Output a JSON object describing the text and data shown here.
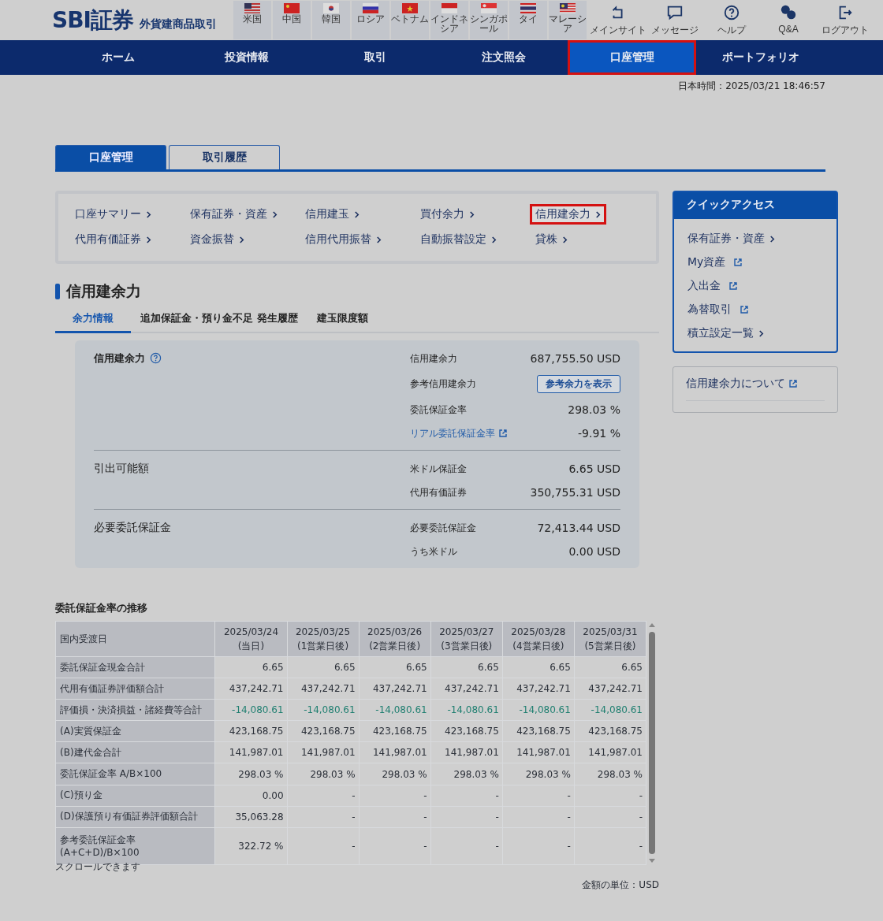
{
  "header": {
    "logo": "SBI証券",
    "subtitle": "外貨建商品取引",
    "markets": [
      {
        "label": "米国"
      },
      {
        "label": "中国"
      },
      {
        "label": "韓国"
      },
      {
        "label": "ロシア"
      },
      {
        "label": "ベトナム"
      },
      {
        "label": "インドネシア"
      },
      {
        "label": "シンガポール"
      },
      {
        "label": "タイ"
      },
      {
        "label": "マレーシア"
      }
    ],
    "tools": [
      {
        "label": "メインサイト"
      },
      {
        "label": "メッセージ"
      },
      {
        "label": "ヘルプ"
      },
      {
        "label": "Q&A"
      },
      {
        "label": "ログアウト"
      }
    ]
  },
  "nav": [
    {
      "label": "ホーム",
      "selected": false,
      "highlighted": false
    },
    {
      "label": "投資情報",
      "selected": false,
      "highlighted": false
    },
    {
      "label": "取引",
      "selected": false,
      "highlighted": false
    },
    {
      "label": "注文照会",
      "selected": false,
      "highlighted": false
    },
    {
      "label": "口座管理",
      "selected": true,
      "highlighted": true
    },
    {
      "label": "ポートフォリオ",
      "selected": false,
      "highlighted": false
    }
  ],
  "clock": "日本時間：2025/03/21 18:46:57",
  "tabs": [
    {
      "label": "口座管理",
      "selected": true
    },
    {
      "label": "取引履歴",
      "selected": false
    }
  ],
  "links": [
    {
      "label": "口座サマリー",
      "highlighted": false
    },
    {
      "label": "保有証券・資産",
      "highlighted": false
    },
    {
      "label": "信用建玉",
      "highlighted": false
    },
    {
      "label": "買付余力",
      "highlighted": false
    },
    {
      "label": "信用建余力",
      "highlighted": true
    },
    {
      "label": "代用有価証券",
      "highlighted": false
    },
    {
      "label": "資金振替",
      "highlighted": false
    },
    {
      "label": "信用代用振替",
      "highlighted": false
    },
    {
      "label": "自動振替設定",
      "highlighted": false
    },
    {
      "label": "貸株",
      "highlighted": false
    }
  ],
  "page_title": "信用建余力",
  "subtabs": [
    {
      "label": "余力情報",
      "selected": true
    },
    {
      "label": "追加保証金・預り金不足 発生履歴",
      "selected": false
    },
    {
      "label": "建玉限度額",
      "selected": false
    }
  ],
  "summary": [
    {
      "title": "信用建余力",
      "bold": true,
      "help": true,
      "rows": [
        {
          "kind": "value",
          "label": "信用建余力",
          "value": "687,755.50 USD"
        },
        {
          "kind": "button",
          "label": "参考信用建余力",
          "value": "参考余力を表示"
        },
        {
          "kind": "value",
          "label": "委託保証金率",
          "value": "298.03 %"
        },
        {
          "kind": "link",
          "label": "リアル委託保証金率",
          "value": "-9.91 %"
        }
      ]
    },
    {
      "title": "引出可能額",
      "bold": false,
      "rows": [
        {
          "kind": "value",
          "label": "米ドル保証金",
          "value": "6.65 USD"
        },
        {
          "kind": "value",
          "label": "代用有価証券",
          "value": "350,755.31 USD"
        }
      ]
    },
    {
      "title": "必要委託保証金",
      "bold": false,
      "rows": [
        {
          "kind": "value",
          "label": "必要委託保証金",
          "value": "72,413.44 USD"
        },
        {
          "kind": "value",
          "label": "うち米ドル",
          "value": "0.00 USD"
        }
      ]
    }
  ],
  "history": {
    "title": "委託保証金率の推移",
    "corner": "国内受渡日",
    "columns": [
      {
        "date": "2025/03/24",
        "note": "(当日)"
      },
      {
        "date": "2025/03/25",
        "note": "(1営業日後)"
      },
      {
        "date": "2025/03/26",
        "note": "(2営業日後)"
      },
      {
        "date": "2025/03/27",
        "note": "(3営業日後)"
      },
      {
        "date": "2025/03/28",
        "note": "(4営業日後)"
      },
      {
        "date": "2025/03/31",
        "note": "(5営業日後)"
      }
    ],
    "rows": [
      {
        "label": "委託保証金現金合計",
        "negative": false,
        "cells": [
          "6.65",
          "6.65",
          "6.65",
          "6.65",
          "6.65",
          "6.65"
        ]
      },
      {
        "label": "代用有価証券評価額合計",
        "negative": false,
        "cells": [
          "437,242.71",
          "437,242.71",
          "437,242.71",
          "437,242.71",
          "437,242.71",
          "437,242.71"
        ]
      },
      {
        "label": "評価損・決済損益・諸経費等合計",
        "negative": true,
        "cells": [
          "-14,080.61",
          "-14,080.61",
          "-14,080.61",
          "-14,080.61",
          "-14,080.61",
          "-14,080.61"
        ]
      },
      {
        "label": "(A)実質保証金",
        "negative": false,
        "cells": [
          "423,168.75",
          "423,168.75",
          "423,168.75",
          "423,168.75",
          "423,168.75",
          "423,168.75"
        ]
      },
      {
        "label": "(B)建代金合計",
        "negative": false,
        "cells": [
          "141,987.01",
          "141,987.01",
          "141,987.01",
          "141,987.01",
          "141,987.01",
          "141,987.01"
        ]
      },
      {
        "label": "委託保証金率 A/B×100",
        "negative": false,
        "cells": [
          "298.03 %",
          "298.03 %",
          "298.03 %",
          "298.03 %",
          "298.03 %",
          "298.03 %"
        ]
      },
      {
        "label": "(C)預り金",
        "negative": false,
        "cells": [
          "0.00",
          "-",
          "-",
          "-",
          "-",
          "-"
        ]
      },
      {
        "label": "(D)保護預り有価証券評価額合計",
        "negative": false,
        "cells": [
          "35,063.28",
          "-",
          "-",
          "-",
          "-",
          "-"
        ]
      },
      {
        "label": "参考委託保証金率\n(A+C+D)/B×100",
        "negative": false,
        "cells": [
          "322.72 %",
          "-",
          "-",
          "-",
          "-",
          "-"
        ]
      }
    ],
    "scroll_hint": "スクロールできます",
    "unit": "金額の単位：USD"
  },
  "quick_access": {
    "title": "クイックアクセス",
    "items": [
      {
        "label": "保有証券・資産",
        "kind": "internal"
      },
      {
        "label": "My資産",
        "kind": "external"
      },
      {
        "label": "入出金",
        "kind": "external"
      },
      {
        "label": "為替取引",
        "kind": "external"
      },
      {
        "label": "積立設定一覧",
        "kind": "internal"
      }
    ]
  },
  "about": {
    "label": "信用建余力について"
  }
}
